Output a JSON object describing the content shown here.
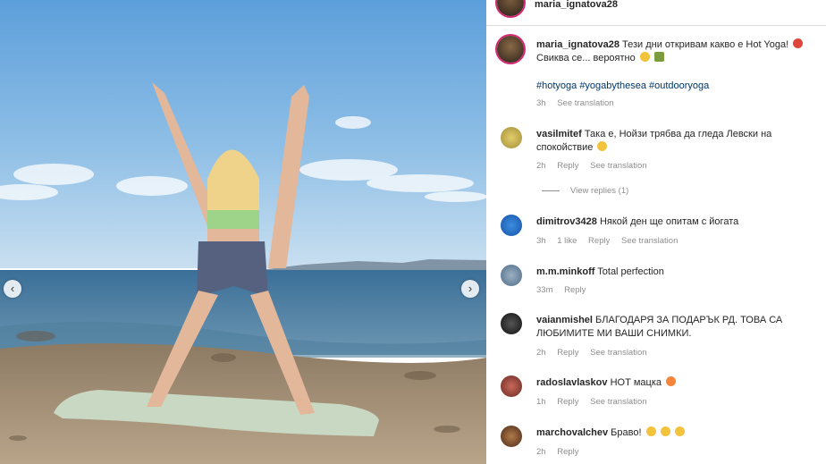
{
  "post": {
    "author": "maria_ignatova28",
    "caption": "Тези дни откривам какво е Hot Yoga!",
    "caption_line2": "Свиква се... вероятно",
    "hashtags": "#hotyoga #yogabythesea #outdooryoga",
    "time": "3h",
    "see_translation": "See translation"
  },
  "carousel": {
    "prev_icon": "‹",
    "next_icon": "›"
  },
  "comments": [
    {
      "user": "vasilmitef",
      "text": "Така е, Нойзи трябва да гледа Левски на",
      "text2": "спокойствие",
      "time": "2h",
      "reply": "Reply",
      "translate": "See translation",
      "view_replies": "View replies (1)"
    },
    {
      "user": "dimitrov3428",
      "text": "Някой ден ще опитам с йогата",
      "time": "3h",
      "likes": "1 like",
      "reply": "Reply",
      "translate": "See translation"
    },
    {
      "user": "m.m.minkoff",
      "text": "Total perfection",
      "time": "33m",
      "reply": "Reply"
    },
    {
      "user": "vaianmishel",
      "text": "БЛАГОДАРЯ ЗА ПОДАРЪК РД. ТОВА СА",
      "text2": "ЛЮБИМИТЕ МИ ВАШИ СНИМКИ.",
      "time": "2h",
      "reply": "Reply",
      "translate": "See translation"
    },
    {
      "user": "radoslavlaskov",
      "text": "НОТ мацка",
      "time": "1h",
      "reply": "Reply",
      "translate": "See translation"
    },
    {
      "user": "marchovalchev",
      "text": "Браво!",
      "time": "2h",
      "reply": "Reply"
    }
  ],
  "colors": {
    "link": "#00376b",
    "muted": "#8e8e8e",
    "text": "#262626"
  }
}
